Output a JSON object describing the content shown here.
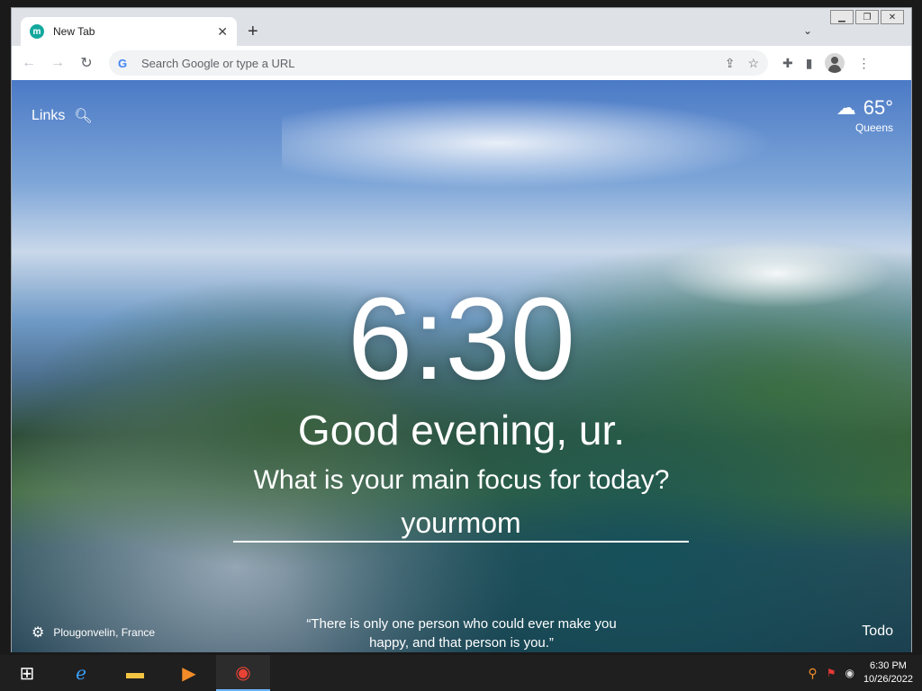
{
  "tab": {
    "title": "New Tab",
    "favicon": "m"
  },
  "omnibox": {
    "placeholder": "Search Google or type a URL"
  },
  "links": {
    "label": "Links"
  },
  "weather": {
    "temp": "65°",
    "city": "Queens"
  },
  "clock": "6:30",
  "greeting": "Good evening, ur.",
  "focus": {
    "question": "What is your main focus for today?",
    "value": "yourmom"
  },
  "photo": {
    "location": "Plougonvelin, France"
  },
  "quote": {
    "line1": "“There is only one person who could ever make you",
    "line2": "happy, and that person is you.”"
  },
  "todo": "Todo",
  "taskbar": {
    "time": "6:30 PM",
    "date": "10/26/2022"
  },
  "colors": {
    "brand": "#13a89e",
    "accent": "#6cb4ff"
  }
}
